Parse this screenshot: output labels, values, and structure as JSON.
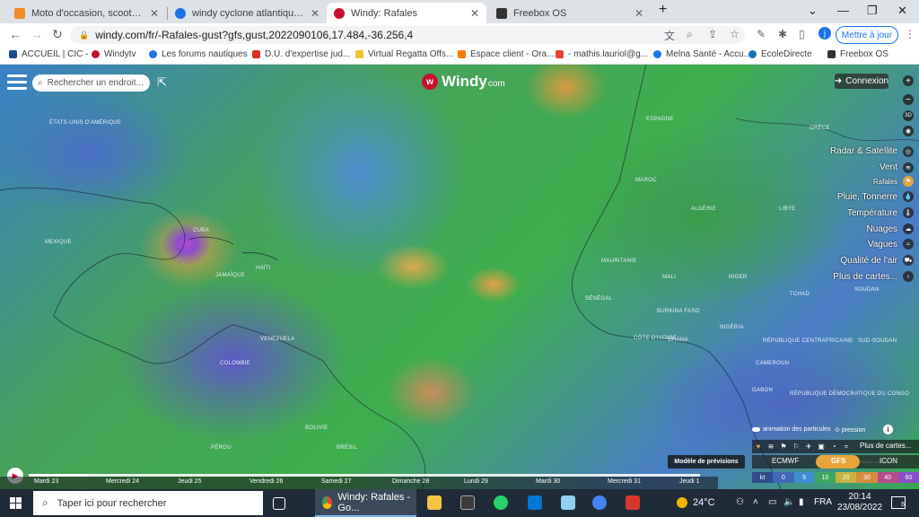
{
  "tabs": [
    {
      "title": "Moto d'occasion, scooter, quad e",
      "fav_color": "#f28c28"
    },
    {
      "title": "windy cyclone atlantique project",
      "fav_color": "#1a73e8"
    },
    {
      "title": "Windy: Rafales",
      "fav_color": "#c8102e"
    },
    {
      "title": "Freebox OS",
      "fav_color": "#333333"
    }
  ],
  "window": {
    "minimize": "—",
    "restore": "❐",
    "close": "✕",
    "chevron": "⌄",
    "new_tab": "+"
  },
  "nav": {
    "back": "←",
    "forward": "→",
    "reload": "↻",
    "url": "windy.com/fr/-Rafales-gust?gfs,gust,2022090106,17.484,-36.256,4",
    "update_label": "Mettre à jour",
    "profile": "j"
  },
  "bookmarks": [
    {
      "label": "ACCUEIL | CIC -",
      "color": "#1a4b8c"
    },
    {
      "label": "Windytv",
      "color": "#c8102e"
    },
    {
      "label": "Les forums nautiques",
      "color": "#1a73e8"
    },
    {
      "label": "D.U. d'expertise jud...",
      "color": "#d93025"
    },
    {
      "label": "Virtual Regatta Offs...",
      "color": "#f2c230"
    },
    {
      "label": "Espace client - Ora...",
      "color": "#ff7900"
    },
    {
      "label": "- mathis.lauriol@g...",
      "color": "#ea4335"
    },
    {
      "label": "Melna Santé - Accu...",
      "color": "#1877f2"
    },
    {
      "label": "EcoleDirecte",
      "color": "#1f6fb5"
    },
    {
      "label": "Freebox OS",
      "color": "#333333"
    }
  ],
  "map": {
    "search_placeholder": "Rechercher un endroit...",
    "logo": "Windy",
    "logo_suffix": "com",
    "connexion": "Connexion",
    "zoom_in": "+",
    "zoom_out": "−",
    "btn_3d": "3D",
    "countries": [
      "ÉTATS-UNIS D'AMÉRIQUE",
      "MEXIQUE",
      "CUBA",
      "HAÏTI",
      "JAMAÏQUE",
      "VENEZUELA",
      "COLOMBIE",
      "PÉROU",
      "BRÉSIL",
      "ESPAGNE",
      "MAROC",
      "ALGÉRIE",
      "LIBYE",
      "MAURITANIE",
      "MALI",
      "NIGER",
      "TCHAD",
      "SOUDAN",
      "NIGÉRIA",
      "RÉPUBLIQUE CENTRAFRICAINE",
      "SUD-SOUDAN",
      "RÉPUBLIQUE DÉMOCRATIQUE DU CONGO",
      "GABON",
      "SÉNÉGAL",
      "CÔTE D'IVOIRE",
      "GHANA",
      "BURKINA FASO",
      "CAMEROUN",
      "GRÈCE",
      "BOLIVIE"
    ],
    "layers": [
      "Radar & Satellite",
      "Vent",
      "Rafales",
      "Pluie, Tonnerre",
      "Température",
      "Nuages",
      "Vagues",
      "Qualité de l'air",
      "Plus de cartes..."
    ],
    "active_layer": "Rafales",
    "model_label": "Modèle de prévisions",
    "particles_label": "animation des particules",
    "pressure_label": "pression",
    "more_maps": "Plus de cartes...",
    "models": [
      "ECMWF",
      "GFS",
      "ICON"
    ],
    "active_model": "GFS",
    "scale": [
      "kt",
      "0",
      "5",
      "10",
      "20",
      "30",
      "40",
      "60"
    ],
    "attribution": "© OpenStreetMap contributors"
  },
  "timeline": {
    "days": [
      "Mardi 23",
      "Mercredi 24",
      "Jeudi 25",
      "Vendredi 26",
      "Samedi 27",
      "Dimanche 28",
      "Lundi 29",
      "Mardi 30",
      "Mercredi 31",
      "Jeudi 1"
    ],
    "progress": 0.09
  },
  "taskbar": {
    "search_placeholder": "Taper ici pour rechercher",
    "active_app": "Windy: Rafales - Go...",
    "weather": "24°C",
    "lang": "FRA",
    "time": "20:14",
    "date": "23/08/2022",
    "notifications": "6"
  },
  "colors": {
    "windy_red": "#c8102e",
    "accent_orange": "#e8a33a",
    "chrome_blue": "#1a73e8",
    "taskbar": "#1f2b38"
  }
}
